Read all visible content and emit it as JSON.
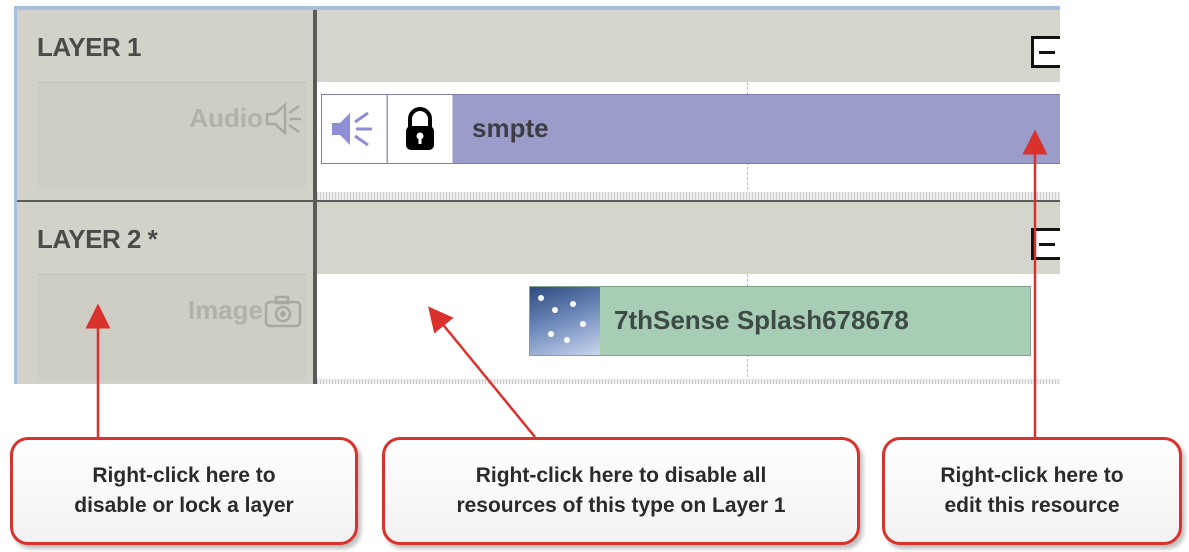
{
  "layers": [
    {
      "title": "LAYER 1",
      "resource_type": "Audio",
      "resource_icon": "speaker-icon"
    },
    {
      "title": "LAYER 2 *",
      "resource_type": "Image",
      "resource_icon": "camera-icon"
    }
  ],
  "clips": {
    "audio": {
      "name": "smpte",
      "icons": [
        "speaker-icon",
        "lock-icon"
      ]
    },
    "image": {
      "name": "7thSense Splash678678",
      "icons": [
        "thumbnail-image"
      ]
    }
  },
  "callouts": [
    {
      "text": "Right-click here to\ndisable or lock a layer"
    },
    {
      "text": "Right-click here to disable all\nresources of this type on Layer 1"
    },
    {
      "text": "Right-click here to\nedit this resource"
    }
  ],
  "colors": {
    "callout_border": "#d9312c",
    "audio_clip": "#9a9cc9",
    "image_clip": "#a7cdb5",
    "header_bg": "#d3d2c8"
  }
}
